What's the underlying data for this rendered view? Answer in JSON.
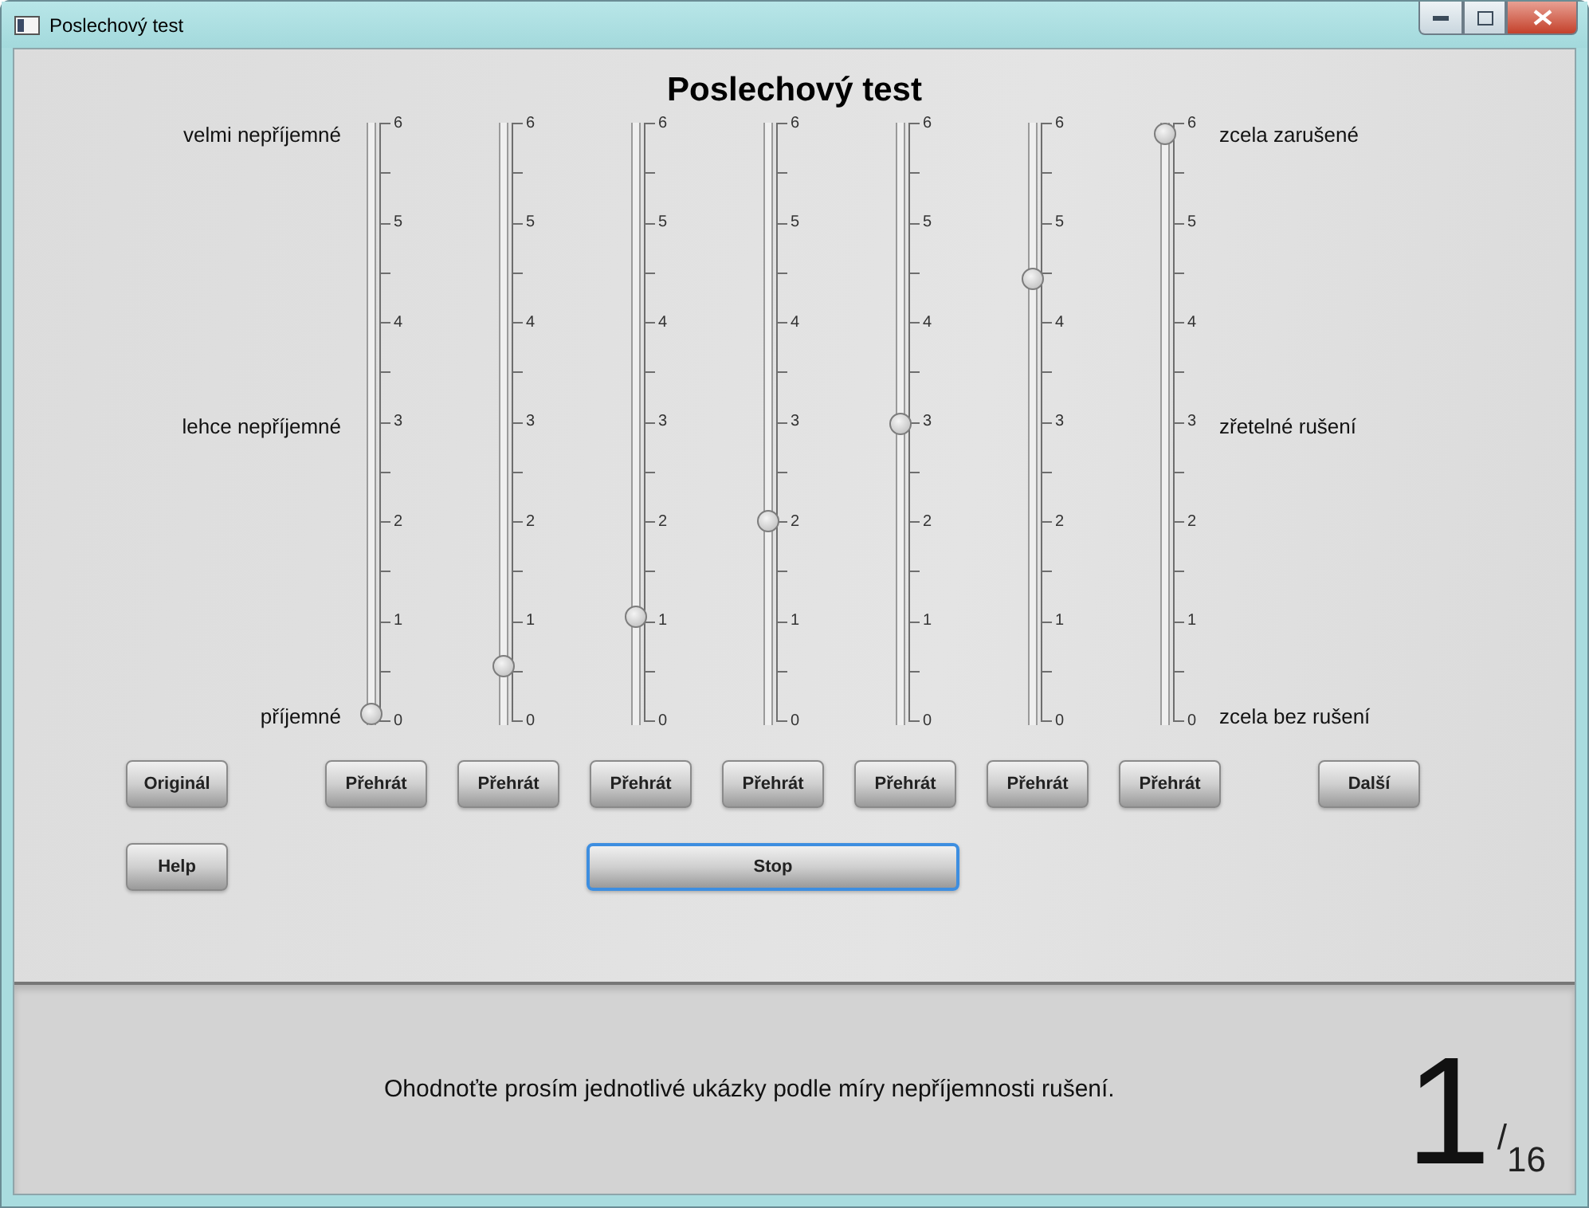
{
  "window": {
    "title": "Poslechový test"
  },
  "heading": "Poslechový test",
  "scale_labels_left": [
    "velmi nepříjemné",
    "lehce nepříjemné",
    "příjemné"
  ],
  "scale_labels_right": [
    "zcela zarušené",
    "zřetelné rušení",
    "zcela bez rušení"
  ],
  "sliders": [
    {
      "level": 0,
      "ticks": [
        "6",
        "5",
        "4",
        "3",
        "2",
        "1",
        "0"
      ],
      "button": "Přehrát"
    },
    {
      "level": 0.0833,
      "ticks": [
        "6",
        "5",
        "4",
        "3",
        "2",
        "1",
        "0"
      ],
      "button": "Přehrát"
    },
    {
      "level": 0.1667,
      "ticks": [
        "6",
        "5",
        "4",
        "3",
        "2",
        "1",
        "0"
      ],
      "button": "Přehrát"
    },
    {
      "level": 0.3333,
      "ticks": [
        "6",
        "5",
        "4",
        "3",
        "2",
        "1",
        "0"
      ],
      "button": "Přehrát"
    },
    {
      "level": 0.5,
      "ticks": [
        "6",
        "5",
        "4",
        "3",
        "2",
        "1",
        "0"
      ],
      "button": "Přehrát"
    },
    {
      "level": 0.75,
      "ticks": [
        "6",
        "5",
        "4",
        "3",
        "2",
        "1",
        "0"
      ],
      "button": "Přehrát"
    },
    {
      "level": 1,
      "ticks": [
        "6",
        "5",
        "4",
        "3",
        "2",
        "1",
        "0"
      ],
      "button": "Přehrát"
    }
  ],
  "original_button": "Originál",
  "next_button": "Další",
  "help_button": "Help",
  "stop_button": {
    "label": "Stop",
    "focused": true
  },
  "instruction": "Ohodnoťte prosím jednotlivé ukázky podle míry nepříjemnosti rušení.",
  "counter": {
    "current": "1",
    "separator": "/",
    "total": "16"
  }
}
